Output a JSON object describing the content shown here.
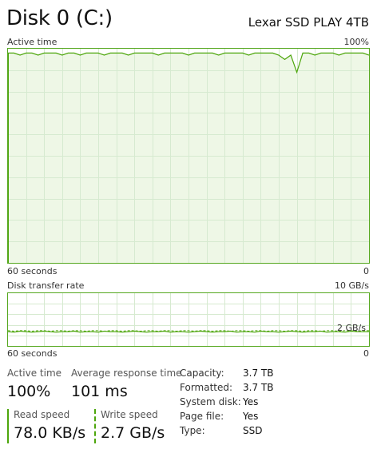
{
  "header": {
    "title": "Disk 0 (C:)",
    "model": "Lexar SSD PLAY 4TB"
  },
  "active_time_graph": {
    "label": "Active time",
    "max_label": "100%",
    "time_label": "60 seconds",
    "min_label": "0",
    "line_color": "#4da60c",
    "fill_color": "#eef7e6",
    "grid_color": "#d6ead0"
  },
  "transfer_graph": {
    "label": "Disk transfer rate",
    "max_label": "10 GB/s",
    "mid_label": "2 GB/s",
    "time_label": "60 seconds",
    "min_label": "0",
    "line_color": "#4da60c"
  },
  "stats": {
    "active_time": {
      "label": "Active time",
      "value": "100%"
    },
    "avg_response": {
      "label": "Average response time",
      "value": "101 ms"
    },
    "read_speed": {
      "label": "Read speed",
      "value": "78.0 KB/s"
    },
    "write_speed": {
      "label": "Write speed",
      "value": "2.7 GB/s"
    }
  },
  "properties": [
    {
      "key": "Capacity:",
      "value": "3.7 TB"
    },
    {
      "key": "Formatted:",
      "value": "3.7 TB"
    },
    {
      "key": "System disk:",
      "value": "Yes"
    },
    {
      "key": "Page file:",
      "value": "Yes"
    },
    {
      "key": "Type:",
      "value": "SSD"
    }
  ],
  "chart_data": [
    {
      "type": "area",
      "title": "Active time",
      "ylim": [
        0,
        100
      ],
      "xlim": [
        60,
        0
      ],
      "xlabel": "60 seconds",
      "series": [
        {
          "values": [
            98,
            98,
            97,
            98,
            98,
            97,
            98,
            98,
            98,
            97,
            98,
            98,
            97,
            98,
            98,
            98,
            97,
            98,
            98,
            98,
            97,
            98,
            98,
            98,
            98,
            97,
            98,
            98,
            98,
            98,
            97,
            98,
            98,
            98,
            98,
            97,
            98,
            98,
            98,
            98,
            97,
            98,
            98,
            98,
            98,
            97,
            95,
            97,
            89,
            98,
            98,
            97,
            98,
            98,
            98,
            97,
            98,
            98,
            98,
            98,
            97
          ]
        }
      ]
    },
    {
      "type": "line",
      "title": "Disk transfer rate",
      "ylim": [
        0,
        10
      ],
      "xlim": [
        60,
        0
      ],
      "xlabel": "60 seconds",
      "series": [
        {
          "values": [
            2.7,
            2.6,
            2.8,
            2.7,
            2.6,
            2.7,
            2.8,
            2.7,
            2.6,
            2.7,
            2.7,
            2.8,
            2.6,
            2.7,
            2.7,
            2.6,
            2.8,
            2.7,
            2.7,
            2.6,
            2.7,
            2.8,
            2.7,
            2.6,
            2.7,
            2.7,
            2.8,
            2.6,
            2.7,
            2.7,
            2.6,
            2.7,
            2.8,
            2.7,
            2.6,
            2.7,
            2.7,
            2.8,
            2.6,
            2.7,
            2.7,
            2.6,
            2.8,
            2.7,
            2.7,
            2.6,
            2.7,
            2.8,
            2.7,
            2.6,
            2.7,
            2.7,
            2.8,
            2.6,
            2.7,
            2.7,
            2.6,
            2.8,
            2.7,
            2.7,
            2.7
          ]
        },
        {
          "values": [
            2.9,
            2.8,
            2.9,
            2.9,
            2.8,
            2.9,
            2.9,
            2.8,
            2.9,
            2.9,
            2.8,
            2.9,
            2.9,
            2.8,
            2.9,
            2.9,
            2.8,
            2.9,
            2.9,
            2.8,
            2.9,
            2.9,
            2.8,
            2.9,
            2.9,
            2.8,
            2.9,
            2.9,
            2.8,
            2.9,
            2.9,
            2.8,
            2.9,
            2.9,
            2.8,
            2.9,
            2.9,
            2.8,
            2.9,
            2.9,
            2.8,
            2.9,
            2.9,
            2.8,
            2.9,
            2.9,
            2.8,
            2.9,
            2.9,
            2.8,
            2.9,
            2.9,
            2.8,
            2.9,
            2.9,
            2.8,
            2.9,
            2.9,
            2.8,
            2.9,
            2.9
          ]
        }
      ]
    }
  ]
}
